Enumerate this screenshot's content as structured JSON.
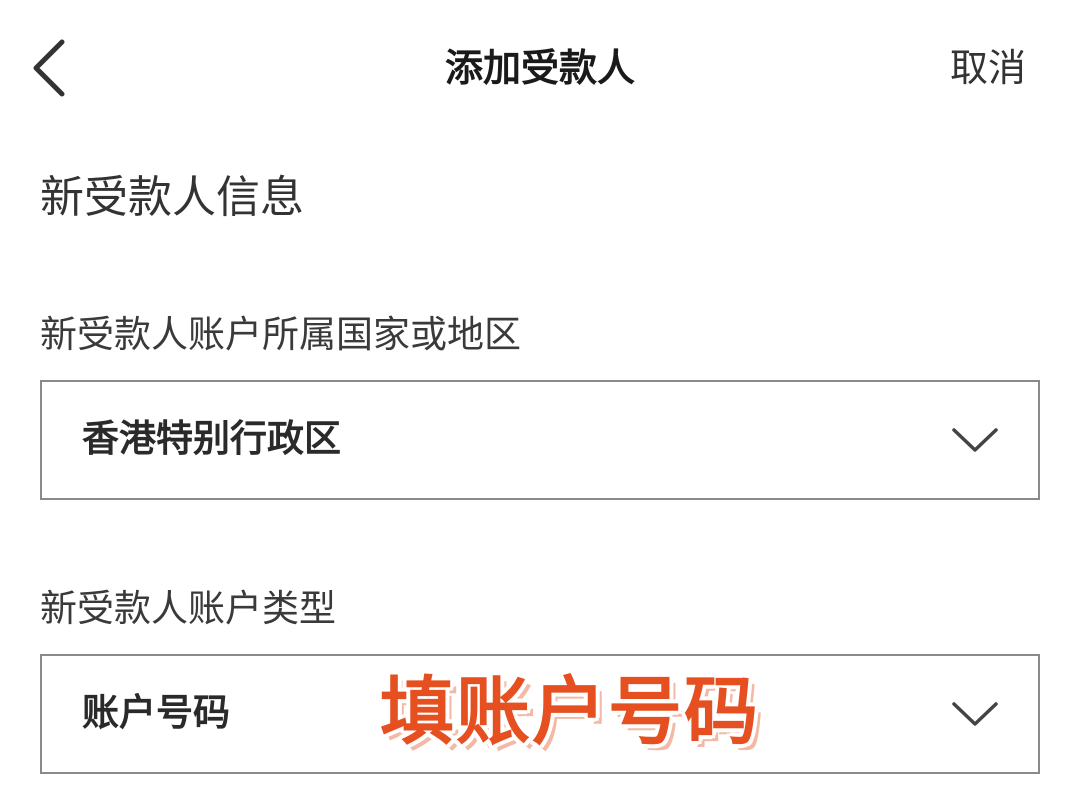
{
  "header": {
    "title": "添加受款人",
    "cancel_label": "取消",
    "back_icon": "chevron-left-icon"
  },
  "form": {
    "section_title": "新受款人信息",
    "country_field": {
      "label": "新受款人账户所属国家或地区",
      "value": "香港特别行政区",
      "icon": "chevron-down-icon"
    },
    "account_type_field": {
      "label": "新受款人账户类型",
      "value": "账户号码",
      "icon": "chevron-down-icon"
    }
  },
  "annotation": {
    "text": "填账户号码",
    "color": "#e64f20"
  }
}
